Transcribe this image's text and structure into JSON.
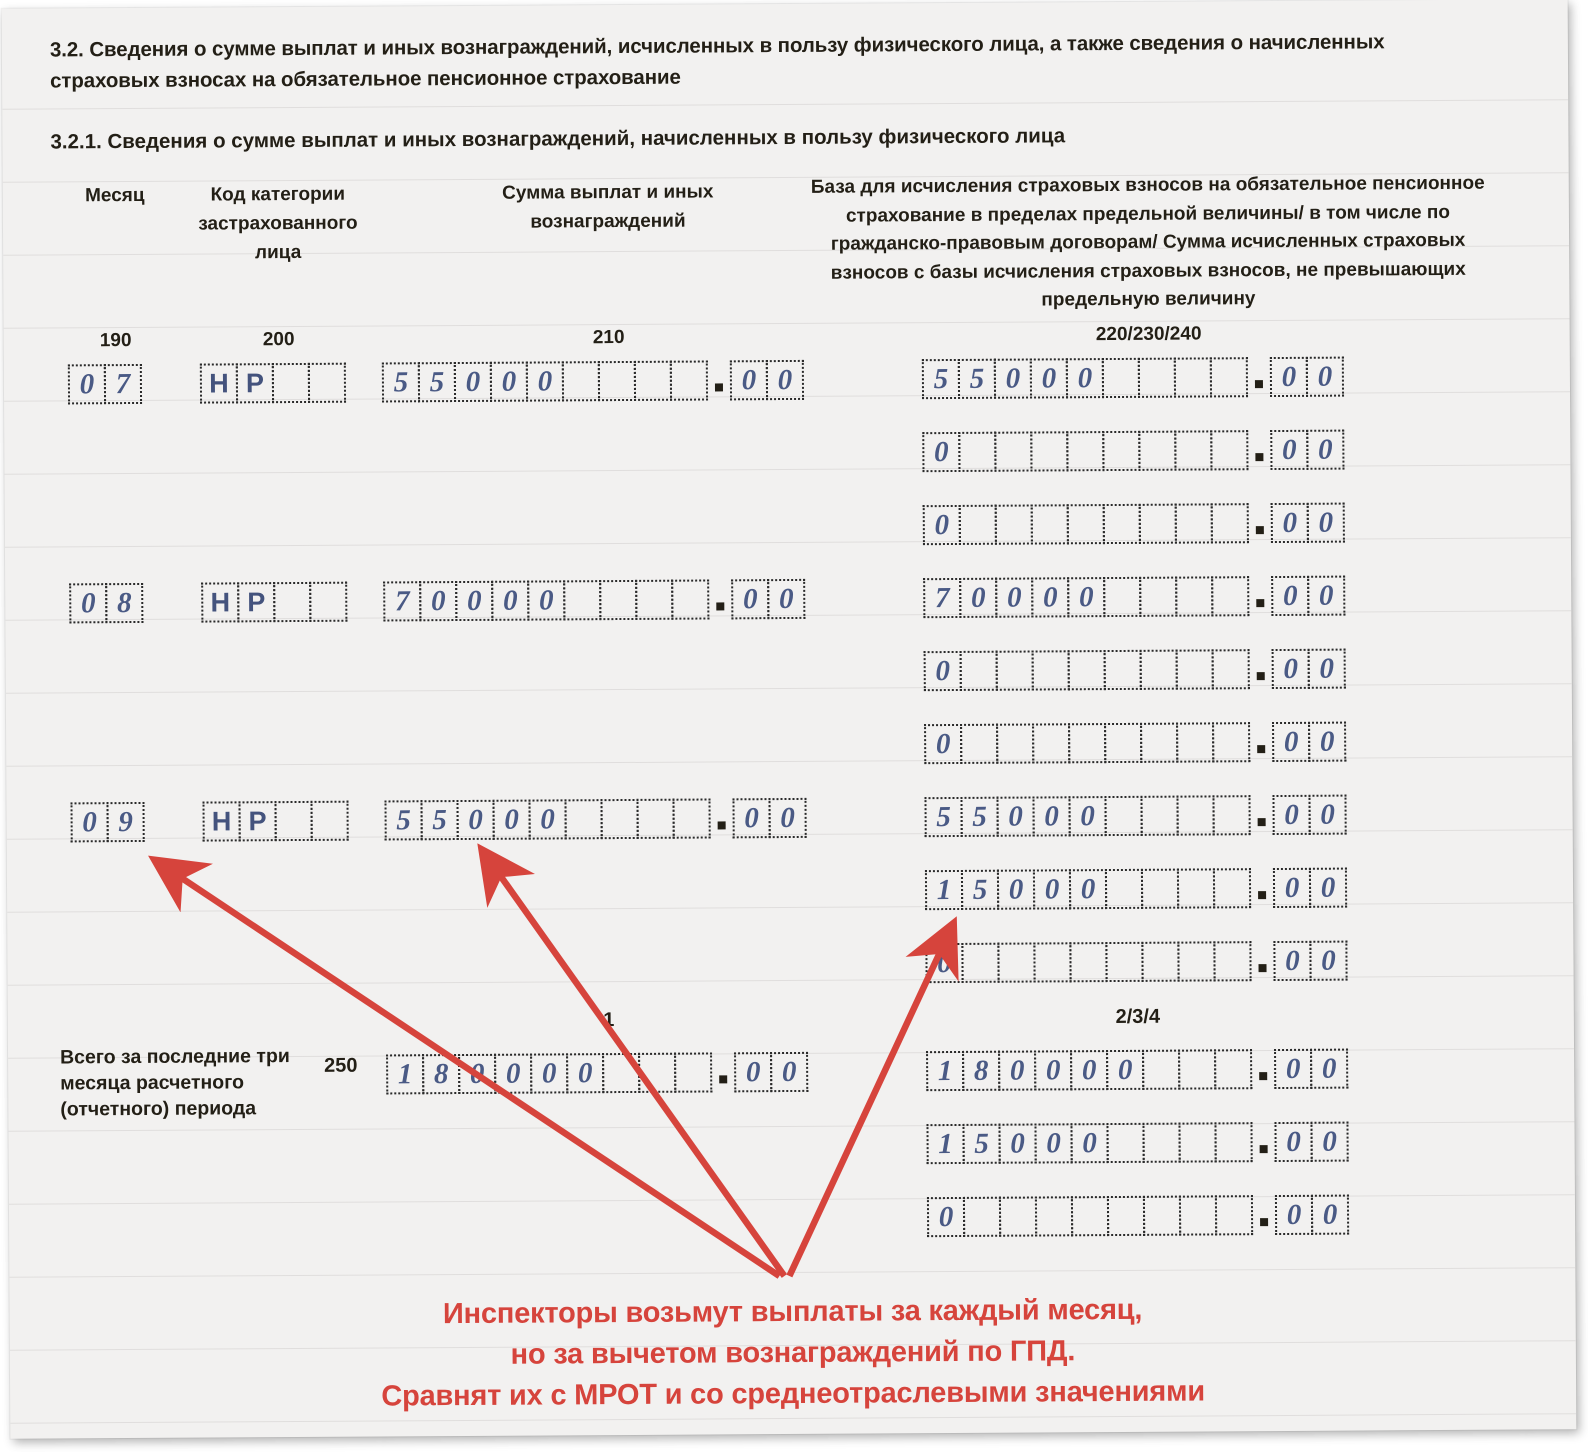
{
  "document": {
    "section_title": "3.2. Сведения о сумме выплат и иных вознаграждений, исчисленных в пользу физического лица, а также сведения о начисленных страховых взносах на обязательное  пенсионное страхование",
    "subsection_title": "3.2.1. Сведения о сумме выплат и иных вознаграждений, начисленных в пользу физического лица"
  },
  "columns": {
    "month": {
      "header": "Месяц",
      "field_no": "190"
    },
    "category_code": {
      "header": "Код категории застрахованного лица",
      "field_no": "200"
    },
    "payments_sum": {
      "header": "Сумма выплат и иных вознаграждений",
      "field_no": "210"
    },
    "base": {
      "header": "База для исчисления страховых взносов на обязательное пенсионное страхование в пределах предельной величины/ в том числе по гражданско-правовым договорам/ Сумма исчисленных страховых взносов с базы исчисления страховых взносов, не превышающих предельную величину",
      "field_no": "220/230/240"
    }
  },
  "markers": {
    "sum_marker": "1",
    "base_marker": "2/3/4"
  },
  "rows": [
    {
      "month": [
        "0",
        "7"
      ],
      "code": [
        "Н",
        "Р",
        "",
        ""
      ],
      "sum_int": [
        "5",
        "5",
        "0",
        "0",
        "0",
        "",
        "",
        "",
        ""
      ],
      "sum_dec": [
        "0",
        "0"
      ],
      "base_int": [
        "5",
        "5",
        "0",
        "0",
        "0",
        "",
        "",
        "",
        ""
      ],
      "base_dec": [
        "0",
        "0"
      ]
    },
    {
      "month": null,
      "code": null,
      "sum_int": null,
      "sum_dec": null,
      "base_int": [
        "0",
        "",
        "",
        "",
        "",
        "",
        "",
        "",
        ""
      ],
      "base_dec": [
        "0",
        "0"
      ]
    },
    {
      "month": null,
      "code": null,
      "sum_int": null,
      "sum_dec": null,
      "base_int": [
        "0",
        "",
        "",
        "",
        "",
        "",
        "",
        "",
        ""
      ],
      "base_dec": [
        "0",
        "0"
      ]
    },
    {
      "month": [
        "0",
        "8"
      ],
      "code": [
        "Н",
        "Р",
        "",
        ""
      ],
      "sum_int": [
        "7",
        "0",
        "0",
        "0",
        "0",
        "",
        "",
        "",
        ""
      ],
      "sum_dec": [
        "0",
        "0"
      ],
      "base_int": [
        "7",
        "0",
        "0",
        "0",
        "0",
        "",
        "",
        "",
        ""
      ],
      "base_dec": [
        "0",
        "0"
      ]
    },
    {
      "month": null,
      "code": null,
      "sum_int": null,
      "sum_dec": null,
      "base_int": [
        "0",
        "",
        "",
        "",
        "",
        "",
        "",
        "",
        ""
      ],
      "base_dec": [
        "0",
        "0"
      ]
    },
    {
      "month": null,
      "code": null,
      "sum_int": null,
      "sum_dec": null,
      "base_int": [
        "0",
        "",
        "",
        "",
        "",
        "",
        "",
        "",
        ""
      ],
      "base_dec": [
        "0",
        "0"
      ]
    },
    {
      "month": [
        "0",
        "9"
      ],
      "code": [
        "Н",
        "Р",
        "",
        ""
      ],
      "sum_int": [
        "5",
        "5",
        "0",
        "0",
        "0",
        "",
        "",
        "",
        ""
      ],
      "sum_dec": [
        "0",
        "0"
      ],
      "base_int": [
        "5",
        "5",
        "0",
        "0",
        "0",
        "",
        "",
        "",
        ""
      ],
      "base_dec": [
        "0",
        "0"
      ]
    },
    {
      "month": null,
      "code": null,
      "sum_int": null,
      "sum_dec": null,
      "base_int": [
        "1",
        "5",
        "0",
        "0",
        "0",
        "",
        "",
        "",
        ""
      ],
      "base_dec": [
        "0",
        "0"
      ]
    },
    {
      "month": null,
      "code": null,
      "sum_int": null,
      "sum_dec": null,
      "base_int": [
        "0",
        "",
        "",
        "",
        "",
        "",
        "",
        "",
        ""
      ],
      "base_dec": [
        "0",
        "0"
      ]
    }
  ],
  "total": {
    "label": "Всего за последние три месяца расчетного (отчетного) периода",
    "field_no": "250",
    "sum_int": [
      "1",
      "8",
      "0",
      "0",
      "0",
      "0",
      "",
      "",
      ""
    ],
    "sum_dec": [
      "0",
      "0"
    ],
    "base_rows": [
      {
        "int": [
          "1",
          "8",
          "0",
          "0",
          "0",
          "0",
          "",
          "",
          ""
        ],
        "dec": [
          "0",
          "0"
        ]
      },
      {
        "int": [
          "1",
          "5",
          "0",
          "0",
          "0",
          "",
          "",
          "",
          ""
        ],
        "dec": [
          "0",
          "0"
        ]
      },
      {
        "int": [
          "0",
          "",
          "",
          "",
          "",
          "",
          "",
          "",
          ""
        ],
        "dec": [
          "0",
          "0"
        ]
      }
    ]
  },
  "annotation": {
    "line1": "Инспекторы возьмут выплаты за каждый месяц,",
    "line2": "но за вычетом вознаграждений по ГПД.",
    "line3": "Сравнят их с МРОТ и со среднеотраслевыми значениями",
    "color": "#d6443c"
  },
  "colors": {
    "paper": "#f2f1f0",
    "ink_value": "#4a5a85",
    "ink_text": "#231f16",
    "rule_line": "#e0dedd",
    "accent_red": "#d6443c"
  }
}
